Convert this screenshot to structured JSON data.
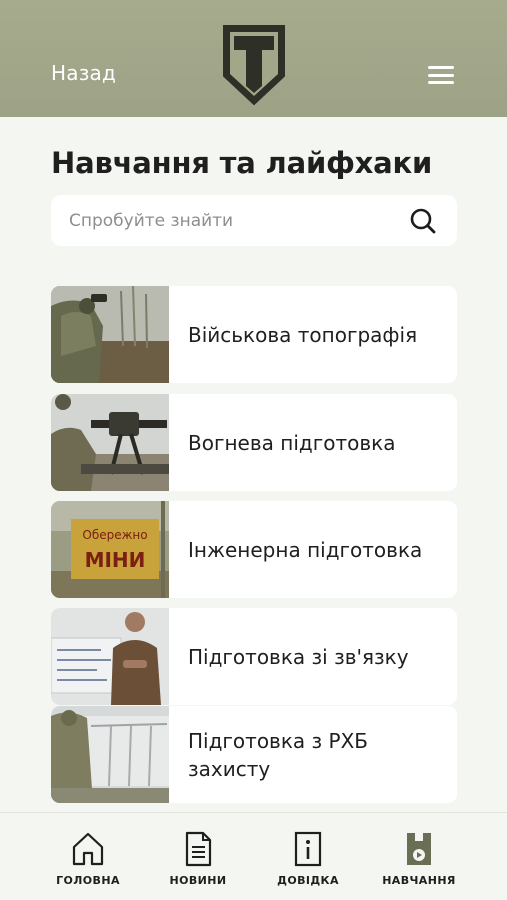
{
  "header": {
    "back_label": "Назад",
    "logo_icon": "shield-t-logo",
    "menu_icon": "hamburger-menu-icon",
    "background_color": "#a3a78a"
  },
  "page": {
    "title": "Навчання та лайфхаки"
  },
  "search": {
    "placeholder": "Спробуйте знайти",
    "value": "",
    "icon": "search-icon"
  },
  "cards": [
    {
      "label": "Військова топографія",
      "thumbnail": "soldier-with-binoculars-photo"
    },
    {
      "label": "Вогнева підготовка",
      "thumbnail": "soldier-with-machine-gun-photo"
    },
    {
      "label": "Інженерна підготовка",
      "thumbnail": "mines-warning-sign-photo"
    },
    {
      "label": "Підготовка зі зв'язку",
      "thumbnail": "instructor-at-whiteboard-photo"
    },
    {
      "label": "Підготовка з РХБ захисту",
      "thumbnail": "soldiers-in-protective-gear-photo"
    }
  ],
  "warning_sign": {
    "line1": "Обережно",
    "line2": "МІНИ"
  },
  "tabbar": {
    "items": [
      {
        "label": "ГОЛОВНА",
        "icon": "home-icon",
        "active": false
      },
      {
        "label": "НОВИНИ",
        "icon": "document-icon",
        "active": false
      },
      {
        "label": "ДОВІДКА",
        "icon": "info-icon",
        "active": false
      },
      {
        "label": "НАВЧАННЯ",
        "icon": "training-play-icon",
        "active": true
      }
    ]
  },
  "colors": {
    "accent": "#6a6e55",
    "background": "#f4f6f1",
    "card": "#ffffff"
  }
}
